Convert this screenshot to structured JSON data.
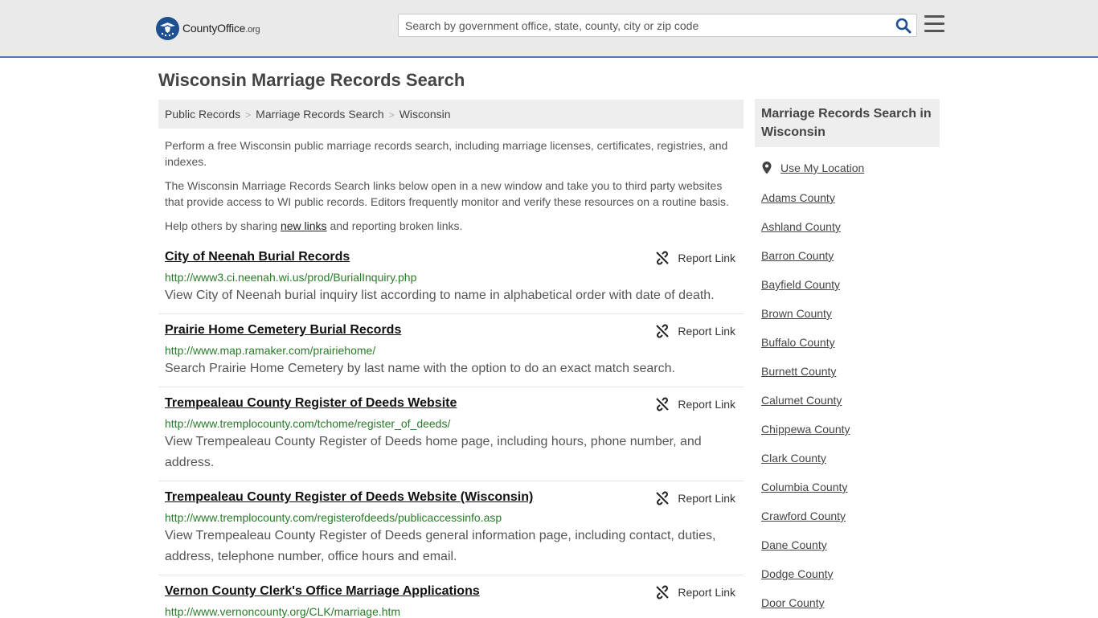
{
  "header": {
    "logo_text": "CountyOffice",
    "logo_suffix": ".org",
    "search_placeholder": "Search by government office, state, county, city or zip code"
  },
  "page": {
    "title": "Wisconsin Marriage Records Search",
    "breadcrumb": [
      "Public Records",
      "Marriage Records Search",
      "Wisconsin"
    ],
    "intro_1": "Perform a free Wisconsin public marriage records search, including marriage licenses, certificates, registries, and indexes.",
    "intro_2": "The Wisconsin Marriage Records Search links below open in a new window and take you to third party websites that provide access to WI public records. Editors frequently monitor and verify these resources on a routine basis.",
    "help_prefix": "Help others by sharing ",
    "help_link": "new links",
    "help_suffix": " and reporting broken links."
  },
  "report_label": "Report Link",
  "records": [
    {
      "title": "City of Neenah Burial Records",
      "url": "http://www3.ci.neenah.wi.us/prod/BurialInquiry.php",
      "desc": "View City of Neenah burial inquiry list according to name in alphabetical order with date of death."
    },
    {
      "title": "Prairie Home Cemetery Burial Records",
      "url": "http://www.map.ramaker.com/prairiehome/",
      "desc": "Search Prairie Home Cemetery by last name with the option to do an exact match search."
    },
    {
      "title": "Trempealeau County Register of Deeds Website",
      "url": "http://www.tremplocounty.com/tchome/register_of_deeds/",
      "desc": "View Trempealeau County Register of Deeds home page, including hours, phone number, and address."
    },
    {
      "title": "Trempealeau County Register of Deeds Website (Wisconsin)",
      "url": "http://www.tremplocounty.com/registerofdeeds/publicaccessinfo.asp",
      "desc": "View Trempealeau County Register of Deeds general information page, including contact, duties, address, telephone number, office hours and email."
    },
    {
      "title": "Vernon County Clerk's Office Marriage Applications",
      "url": "http://www.vernoncounty.org/CLK/marriage.htm",
      "desc": ""
    }
  ],
  "sidebar": {
    "heading": "Marriage Records Search in Wisconsin",
    "use_location": "Use My Location",
    "counties": [
      "Adams County",
      "Ashland County",
      "Barron County",
      "Bayfield County",
      "Brown County",
      "Buffalo County",
      "Burnett County",
      "Calumet County",
      "Chippewa County",
      "Clark County",
      "Columbia County",
      "Crawford County",
      "Dane County",
      "Dodge County",
      "Door County"
    ]
  },
  "colors": {
    "header_bg": "#eaeaea",
    "header_border": "#4a78b8",
    "search_icon": "#1d4f91",
    "url_green": "#2a7a2a"
  }
}
